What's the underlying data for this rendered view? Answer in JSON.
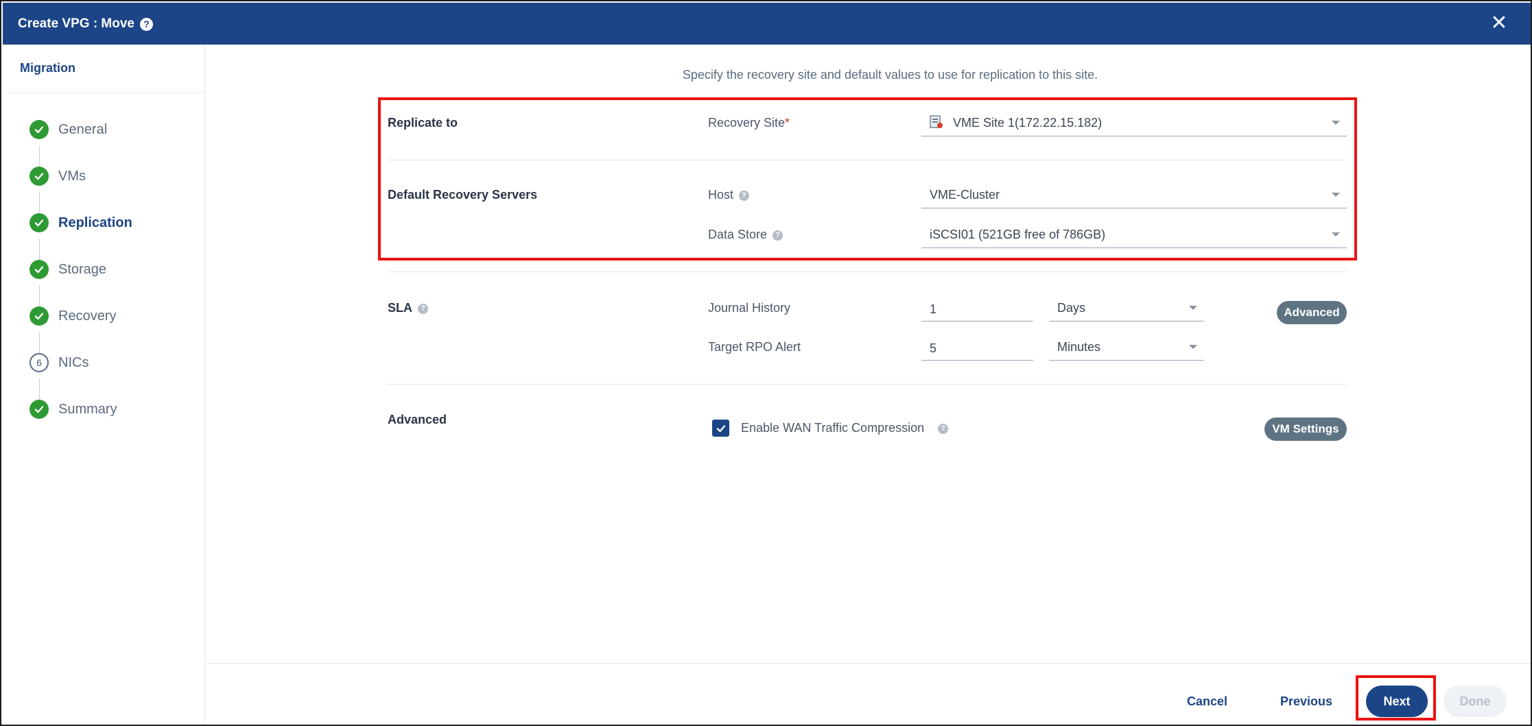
{
  "window": {
    "title": "Create VPG : Move",
    "close_glyph": "✕"
  },
  "sidebar": {
    "heading": "Migration",
    "steps": [
      {
        "label": "General",
        "status": "done"
      },
      {
        "label": "VMs",
        "status": "done"
      },
      {
        "label": "Replication",
        "status": "done",
        "active": true
      },
      {
        "label": "Storage",
        "status": "done"
      },
      {
        "label": "Recovery",
        "status": "done"
      },
      {
        "label": "NICs",
        "status": "pending",
        "number": "6"
      },
      {
        "label": "Summary",
        "status": "done"
      }
    ]
  },
  "main": {
    "intro": "Specify the recovery site and default values to use for replication to this site.",
    "replicate_to": {
      "section_label": "Replicate to",
      "recovery_site_label": "Recovery Site",
      "required_mark": "*",
      "recovery_site_value": "VME Site 1(172.22.15.182)"
    },
    "default_recovery_servers": {
      "section_label": "Default Recovery Servers",
      "host_label": "Host",
      "host_value": "VME-Cluster",
      "datastore_label": "Data Store",
      "datastore_value": "iSCSI01 (521GB free of 786GB)"
    },
    "sla": {
      "section_label": "SLA",
      "journal_history_label": "Journal History",
      "journal_history_value": "1",
      "journal_history_unit": "Days",
      "target_rpo_label": "Target RPO Alert",
      "target_rpo_value": "5",
      "target_rpo_unit": "Minutes",
      "advanced_button": "Advanced"
    },
    "advanced": {
      "section_label": "Advanced",
      "wan_compression_label": "Enable WAN Traffic Compression",
      "wan_compression_checked": true,
      "vm_settings_button": "VM Settings"
    },
    "help_glyph": "?"
  },
  "footer": {
    "cancel": "Cancel",
    "previous": "Previous",
    "next": "Next",
    "done": "Done"
  },
  "colors": {
    "brand": "#1c4587",
    "success": "#2e9a33",
    "highlight": "#ee1111",
    "pill": "#5f7483"
  }
}
